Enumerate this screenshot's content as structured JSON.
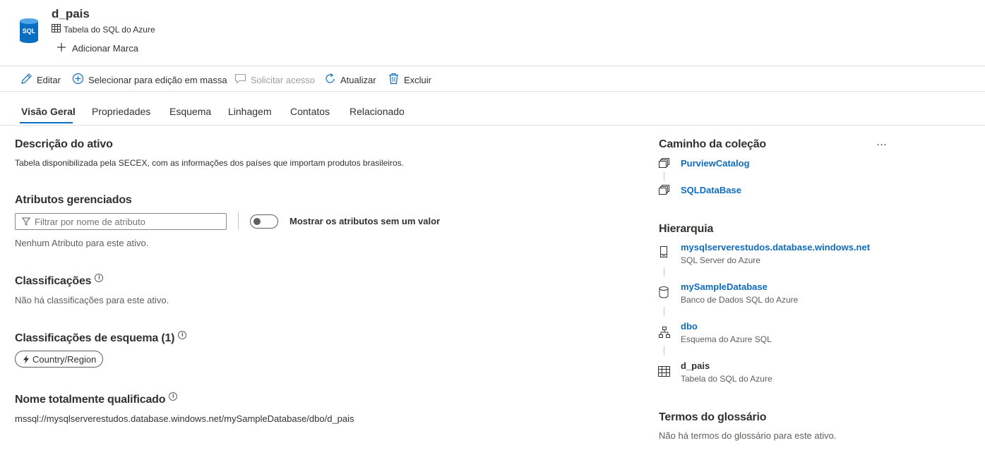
{
  "asset": {
    "name": "d_pais",
    "type_label": "Tabela do SQL do Azure",
    "icon_text": "SQL",
    "add_tag_label": "Adicionar Marca"
  },
  "toolbar": {
    "edit": "Editar",
    "bulk_edit": "Selecionar para edição em massa",
    "request_access": "Solicitar acesso",
    "refresh": "Atualizar",
    "delete": "Excluir"
  },
  "tabs": [
    {
      "label": "Visão Geral",
      "active": true
    },
    {
      "label": "Propriedades"
    },
    {
      "label": "Esquema"
    },
    {
      "label": "Linhagem"
    },
    {
      "label": "Contatos"
    },
    {
      "label": "Relacionado"
    }
  ],
  "main": {
    "description": {
      "title": "Descrição do ativo",
      "text": "Tabela disponibilizada pela SECEX, com as informações dos países que importam produtos brasileiros."
    },
    "managed_attributes": {
      "title": "Atributos gerenciados",
      "filter_placeholder": "Filtrar por nome de atributo",
      "toggle_label": "Mostrar os atributos sem um valor",
      "empty_text": "Nenhum Atributo para este ativo."
    },
    "classifications": {
      "title": "Classificações",
      "empty_text": "Não há classificações para este ativo."
    },
    "schema_classifications": {
      "title": "Classificações de esquema (1)",
      "tags": [
        "Country/Region"
      ]
    },
    "fqn": {
      "title": "Nome totalmente qualificado",
      "value": "mssql://mysqlserverestudos.database.windows.net/mySampleDatabase/dbo/d_pais"
    }
  },
  "side": {
    "collection_path": {
      "title": "Caminho da coleção",
      "more": "···",
      "items": [
        "PurviewCatalog",
        "SQLDataBase"
      ]
    },
    "hierarchy": {
      "title": "Hierarquia",
      "items": [
        {
          "name": "mysqlserverestudos.database.windows.net",
          "type": "SQL Server do Azure",
          "icon": "server-icon"
        },
        {
          "name": "mySampleDatabase",
          "type": "Banco de Dados SQL do Azure",
          "icon": "database-icon"
        },
        {
          "name": "dbo",
          "type": "Esquema do Azure SQL",
          "icon": "schema-icon"
        },
        {
          "name": "d_pais",
          "type": "Tabela do SQL do Azure",
          "icon": "table-icon"
        }
      ]
    },
    "glossary": {
      "title": "Termos do glossário",
      "empty_text": "Não há termos do glossário para este ativo."
    }
  },
  "colors": {
    "accent": "#0f6cbd",
    "sql_icon": "#0a6fc2",
    "divider": "#e1dfdd"
  }
}
